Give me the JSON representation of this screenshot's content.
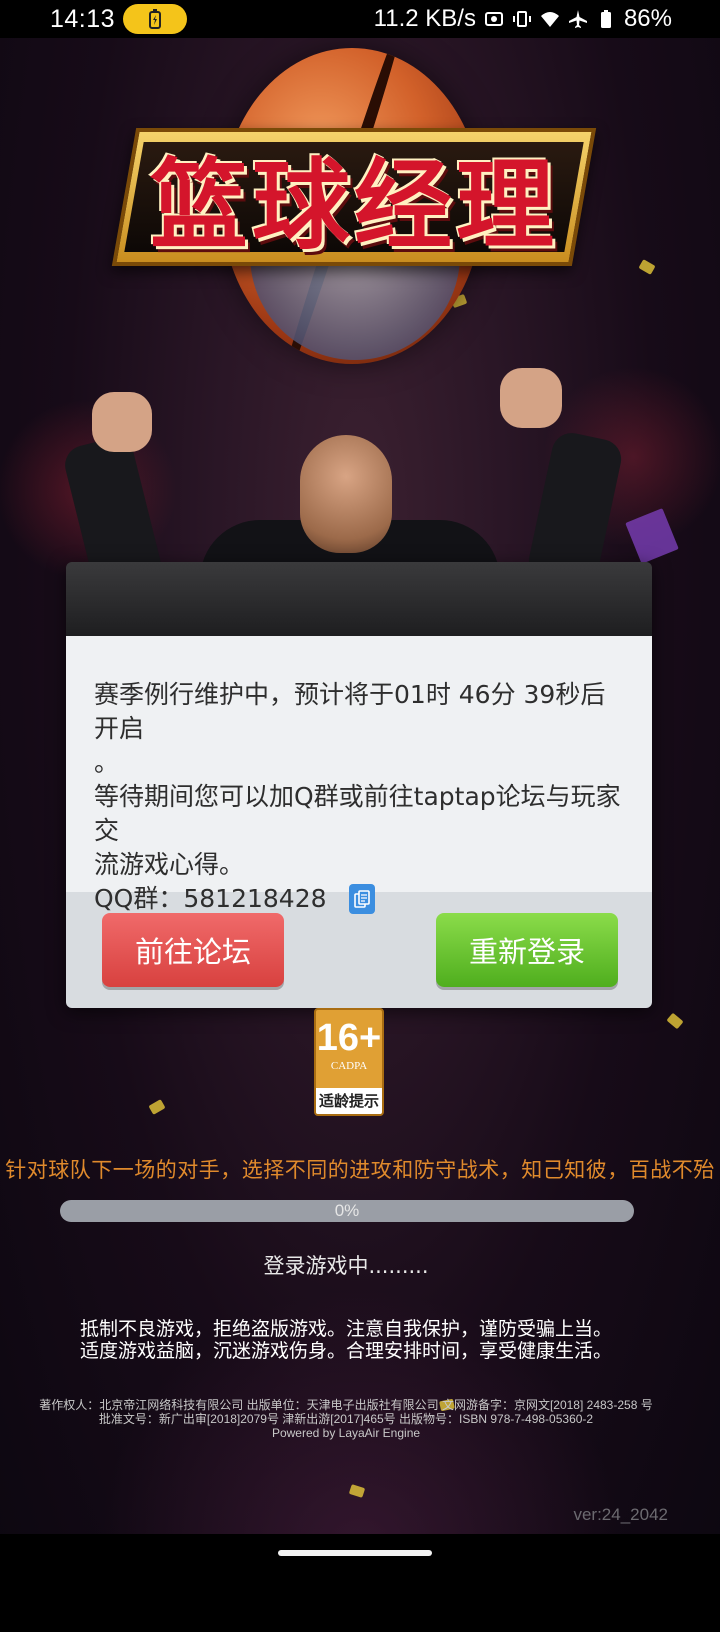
{
  "status_bar": {
    "time": "14:13",
    "network_speed": "11.2 KB/s",
    "battery": "86%"
  },
  "logo": {
    "title": "篮球经理"
  },
  "dialog": {
    "message_line1": "赛季例行维护中，预计将于01时 46分 39秒后开启",
    "message_line1_tail": "。",
    "message_line2": "等待期间您可以加Q群或前往taptap论坛与玩家交",
    "message_line3": "流游戏心得。",
    "qq_label": "QQ群：",
    "qq_number": "581218428",
    "forum_button": "前往论坛",
    "relogin_button": "重新登录"
  },
  "age_rating": {
    "age": "16+",
    "org": "CADPA",
    "tip": "适龄提示"
  },
  "tip": "针对球队下一场的对手，选择不同的进攻和防守战术，知己知彼，百战不殆",
  "progress": {
    "value": 0,
    "label": "0%"
  },
  "loading_text": "登录游戏中.........",
  "notice": {
    "line1": "抵制不良游戏，拒绝盗版游戏。注意自我保护，谨防受骗上当。",
    "line2": "适度游戏益脑，沉迷游戏伤身。合理安排时间，享受健康生活。"
  },
  "copyright": {
    "line1": "著作权人：北京帝江网络科技有限公司 出版单位：天津电子出版社有限公司 文网游备字：京网文[2018] 2483-258 号",
    "line2": "批准文号：新广出审[2018]2079号   津新出游[2017]465号    出版物号：ISBN 978-7-498-05360-2",
    "line3": "Powered by LayaAir Engine"
  },
  "version": "ver:24_2042",
  "colors": {
    "forum_button": "#e05452",
    "relogin_button": "#6cc636",
    "tip_text": "#e08a2c",
    "logo_red": "#d4152b"
  }
}
